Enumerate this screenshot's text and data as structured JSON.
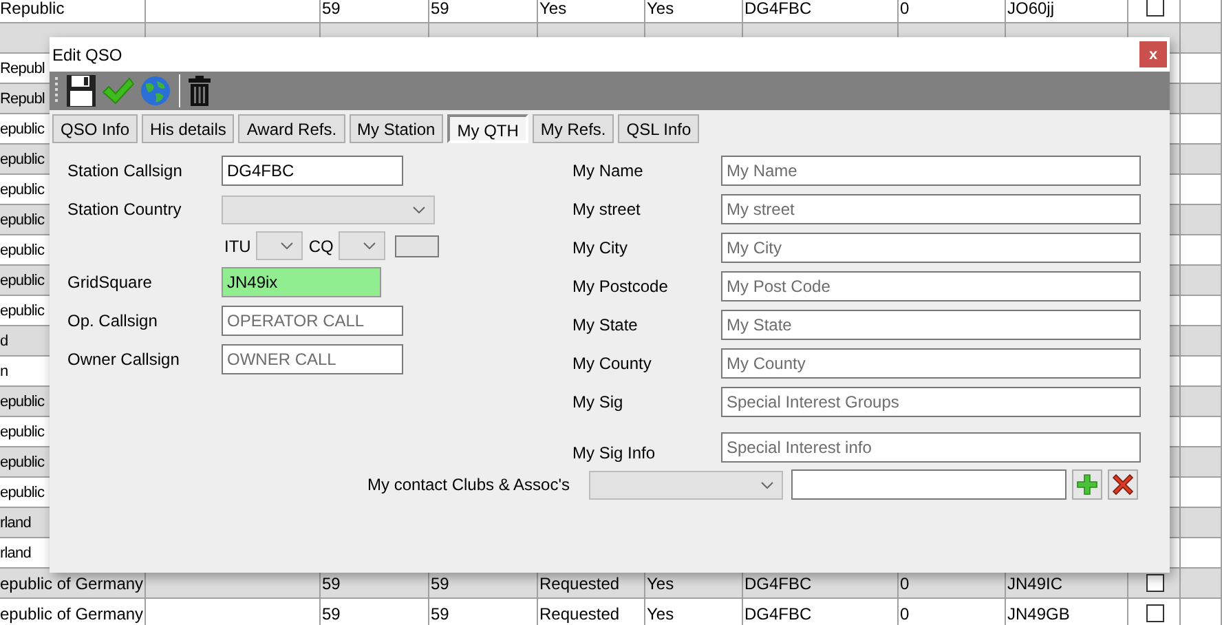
{
  "table": {
    "rows": [
      {
        "cells": [
          "Republic",
          null,
          "59",
          "59",
          "Yes",
          "Yes",
          "DG4FBC",
          "0",
          "JO60jj"
        ],
        "checked": false
      },
      {
        "cells": []
      },
      {
        "cells": [
          "Republ"
        ]
      },
      {
        "cells": [
          "Republ"
        ]
      },
      {
        "cells": [
          "epublic"
        ]
      },
      {
        "cells": [
          "epublic"
        ]
      },
      {
        "cells": [
          "epublic"
        ]
      },
      {
        "cells": [
          "epublic"
        ]
      },
      {
        "cells": [
          "epublic"
        ]
      },
      {
        "cells": [
          "epublic"
        ]
      },
      {
        "cells": [
          "epublic"
        ]
      },
      {
        "cells": [
          "d"
        ]
      },
      {
        "cells": [
          "n"
        ]
      },
      {
        "cells": [
          "epublic"
        ]
      },
      {
        "cells": [
          "epublic"
        ]
      },
      {
        "cells": [
          "epublic"
        ]
      },
      {
        "cells": [
          "epublic"
        ]
      },
      {
        "cells": [
          "rland"
        ]
      },
      {
        "cells": [
          "rland"
        ]
      },
      {
        "cells": [
          "epublic of Germany",
          null,
          "59",
          "59",
          "Requested",
          "Yes",
          "DG4FBC",
          "0",
          "JN49IC"
        ],
        "checked": false
      },
      {
        "cells": [
          "epublic of Germany",
          null,
          "59",
          "59",
          "Requested",
          "Yes",
          "DG4FBC",
          "0",
          "JN49GB"
        ],
        "checked": false
      }
    ]
  },
  "dialog": {
    "title": "Edit QSO",
    "close_label": "x",
    "tabs": [
      {
        "label": "QSO Info",
        "selected": false
      },
      {
        "label": "His details",
        "selected": false
      },
      {
        "label": "Award Refs.",
        "selected": false
      },
      {
        "label": "My Station",
        "selected": false
      },
      {
        "label": "My QTH",
        "selected": true
      },
      {
        "label": "My Refs.",
        "selected": false
      },
      {
        "label": "QSL Info",
        "selected": false
      }
    ],
    "station_fields": [
      {
        "kind": "text",
        "label": "Station Callsign",
        "value": "DG4FBC"
      },
      {
        "kind": "select",
        "label": "Station Country",
        "disabled": true
      },
      {
        "kind": "codes",
        "items": [
          {
            "label": "ITU"
          },
          {
            "label": "CQ"
          }
        ]
      },
      {
        "kind": "text",
        "label": "GridSquare",
        "value": "JN49ix",
        "valid": true
      },
      {
        "kind": "text",
        "label": "Op. Callsign",
        "placeholder": "OPERATOR CALL"
      },
      {
        "kind": "text",
        "label": "Owner Callsign",
        "placeholder": "OWNER CALL"
      }
    ],
    "my_fields": [
      {
        "label": "My Name",
        "placeholder": "My Name"
      },
      {
        "label": "My street",
        "placeholder": "My street"
      },
      {
        "label": "My City",
        "placeholder": "My City"
      },
      {
        "label": "My Postcode",
        "placeholder": "My Post Code"
      },
      {
        "label": "My State",
        "placeholder": "My State"
      },
      {
        "label": "My County",
        "placeholder": "My County"
      },
      {
        "label": "My Sig",
        "placeholder": "Special Interest Groups"
      },
      {
        "label": "My Sig Info",
        "placeholder": "Special Interest info"
      }
    ],
    "clubs": {
      "label": "My contact Clubs & Assoc's"
    }
  }
}
